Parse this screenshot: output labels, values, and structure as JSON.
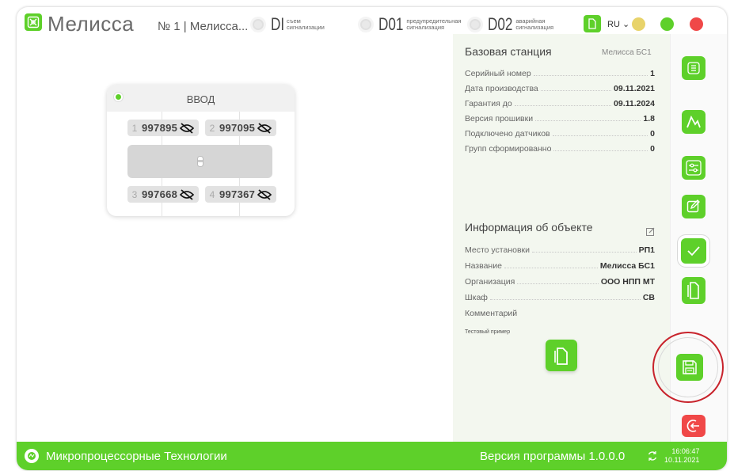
{
  "header": {
    "app_name": "Мелисса",
    "object_title": "№ 1 | Мелисса...",
    "indicators": [
      {
        "code": "DI",
        "desc1": "съем",
        "desc2": "сигнализации"
      },
      {
        "code": "D01",
        "desc1": "предупредительная",
        "desc2": "сигнализация"
      },
      {
        "code": "D02",
        "desc1": "аварийная",
        "desc2": "сигнализация"
      }
    ],
    "language": "RU",
    "colors": {
      "accent": "#5ed02a",
      "yellow": "#e8d36a",
      "green": "#5ed02a",
      "red": "#f04848"
    }
  },
  "device": {
    "title": "ВВОД",
    "sensors": [
      {
        "num": "1",
        "value": "997895"
      },
      {
        "num": "2",
        "value": "997095"
      },
      {
        "num": "3",
        "value": "997668"
      },
      {
        "num": "4",
        "value": "997367"
      }
    ]
  },
  "base_station": {
    "title": "Базовая станция",
    "name": "Мелисса БС1",
    "rows": [
      {
        "label": "Серийный номер",
        "value": "1"
      },
      {
        "label": "Дата производства",
        "value": "09.11.2021"
      },
      {
        "label": "Гарантия до",
        "value": "09.11.2024"
      },
      {
        "label": "Версия прошивки",
        "value": "1.8"
      },
      {
        "label": "Подключено датчиков",
        "value": "0"
      },
      {
        "label": "Групп сформированно",
        "value": "0"
      }
    ]
  },
  "object_info": {
    "title": "Информация об объекте",
    "rows": [
      {
        "label": "Место установки",
        "value": "РП1"
      },
      {
        "label": "Название",
        "value": "Мелисса БС1"
      },
      {
        "label": "Организация",
        "value": "ООО НПП МТ"
      },
      {
        "label": "Шкаф",
        "value": "СВ"
      }
    ],
    "comment_label": "Комментарий",
    "comment_value": "Тестовый пример"
  },
  "toolbar": {
    "icons": [
      "list-icon",
      "chart-icon",
      "settings-icon",
      "edit-icon",
      "check-icon",
      "document-icon",
      "save-icon",
      "exit-icon"
    ]
  },
  "footer": {
    "company": "Микропроцессорные Технологии",
    "version": "Версия программы  1.0.0.0",
    "time": "16:06:47",
    "date": "10.11.2021"
  }
}
